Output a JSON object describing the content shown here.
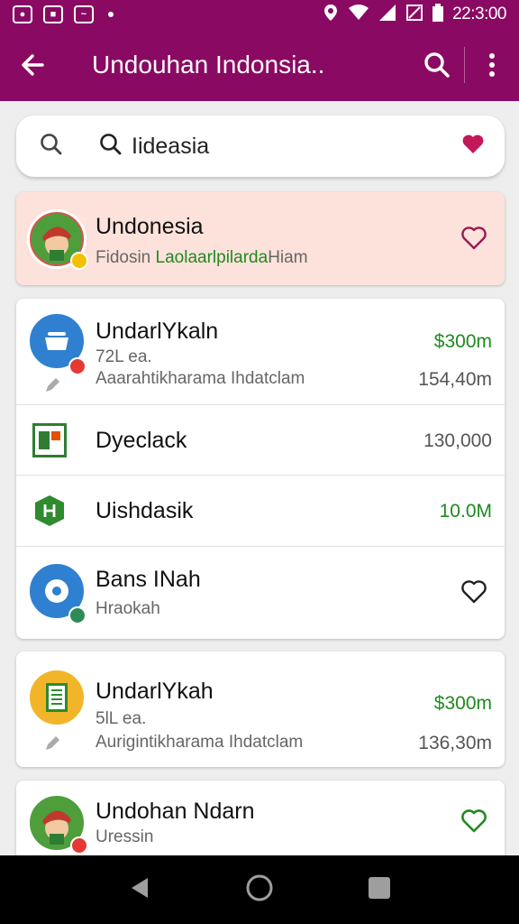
{
  "status_bar": {
    "time": "22:3:00"
  },
  "app_bar": {
    "title": "Undouhan Indonsia.."
  },
  "search": {
    "query": "Iideasia"
  },
  "featured": {
    "title": "Undonesia",
    "subtitle_prefix": "Fidosin",
    "subtitle_highlight": "Laolaarlpilarda",
    "subtitle_suffix": "Hiam"
  },
  "list": [
    {
      "title": "UndarlYkaln",
      "line2": "72L ea.",
      "line3": "Aaarahtikharama Ihdatclam",
      "amount": "$300m",
      "amount2": "154,40m"
    },
    {
      "title": "Dyeclack",
      "amount": "130,000"
    },
    {
      "title": "Uishdasik",
      "amount": "10.0M"
    },
    {
      "title": "Bans INah",
      "subtitle": "Hraokah"
    }
  ],
  "card2": {
    "title": "UndarlYkah",
    "line2": "5lL ea.",
    "line3": "Aurigintikharama Ihdatclam",
    "amount": "$300m",
    "amount2": "136,30m"
  },
  "card3": {
    "title": "Undohan Ndarn",
    "subtitle": "Uressin"
  },
  "colors": {
    "primary": "#8a0a63",
    "highlight_bg": "#fde2db",
    "money_green": "#1f8a1f",
    "heart_pink": "#c2185b"
  }
}
